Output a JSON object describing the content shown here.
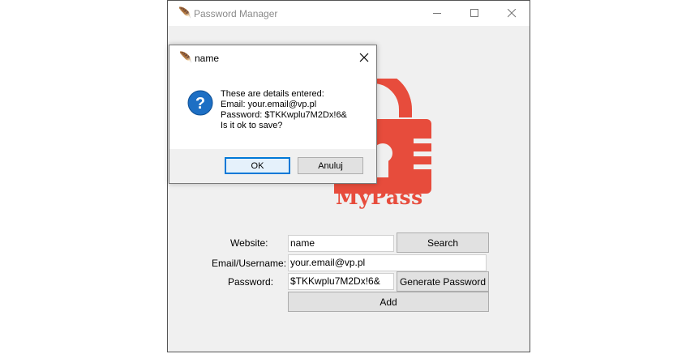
{
  "main_window": {
    "title": "Password Manager",
    "brand": "MyPass",
    "brand_color": "#e74c3c",
    "form": {
      "website_label": "Website:",
      "website_value": "name",
      "email_label": "Email/Username:",
      "email_value": "your.email@vp.pl",
      "password_label": "Password:",
      "password_value": "$TKKwplu7M2Dx!6&",
      "search_button": "Search",
      "generate_button": "Generate Password",
      "add_button": "Add"
    }
  },
  "dialog": {
    "title": "name",
    "message_lines": [
      "These are details entered:",
      "Email: your.email@vp.pl",
      "Password: $TKKwplu7M2Dx!6&",
      "Is it ok to save?"
    ],
    "ok_button": "OK",
    "cancel_button": "Anuluj",
    "icon": "question-icon"
  }
}
